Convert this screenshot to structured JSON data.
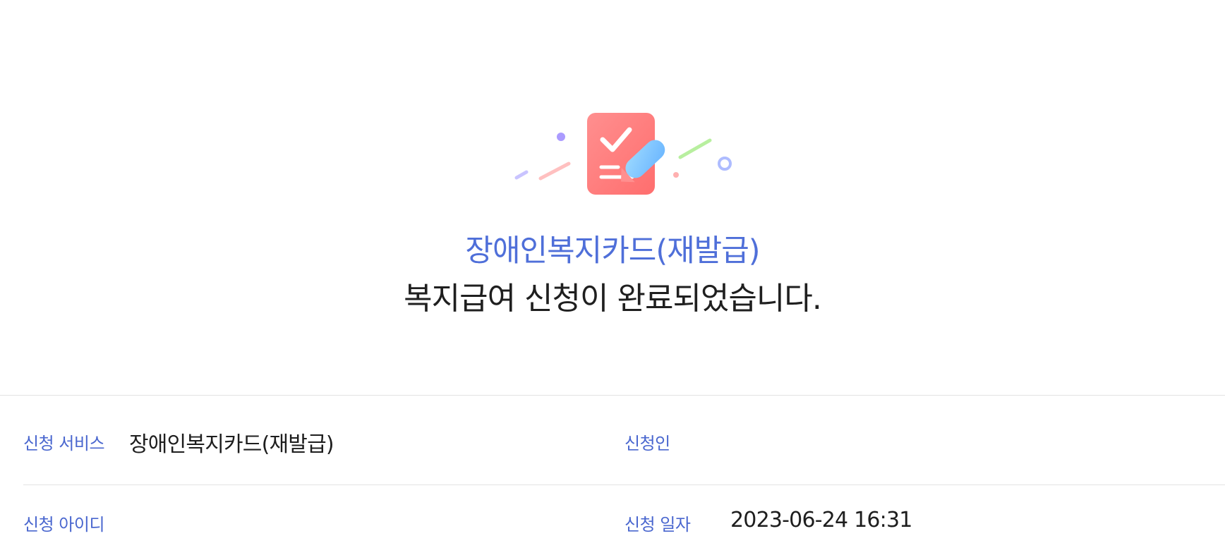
{
  "hero": {
    "service_title": "장애인복지카드(재발급)",
    "completion_message": "복지급여 신청이 완료되었습니다."
  },
  "details": {
    "application_service_label": "신청 서비스",
    "application_service_value": "장애인복지카드(재발급)",
    "applicant_label": "신청인",
    "applicant_value": "",
    "application_id_label": "신청 아이디",
    "application_id_value": "",
    "application_date_label": "신청 일자",
    "application_date_value": "2023-06-24 16:31"
  },
  "icons": {
    "success_illustration": "document-check-edit-icon"
  },
  "colors": {
    "accent": "#4f6fd9",
    "text": "#1f1f1f",
    "divider": "#e3e3e3",
    "document_red": "#ff7b7b",
    "pen_blue": "#84c8ff",
    "confetti_purple": "#ab9bff",
    "confetti_green": "#b8ef9f",
    "confetti_pink": "#ffb8b8"
  }
}
